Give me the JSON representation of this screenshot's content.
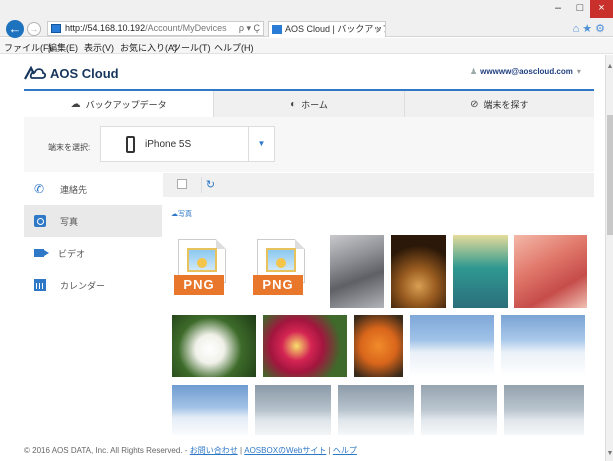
{
  "browser": {
    "url_host": "http://54.168.10.192",
    "url_path": "/Account/MyDevices",
    "url_controls": "ρ ▾ Ç",
    "tab_title": "AOS Cloud | バックアップデータ",
    "tab_close": "×",
    "menu": [
      "ファイル(F)",
      "編集(E)",
      "表示(V)",
      "お気に入り(A)",
      "ツール(T)",
      "ヘルプ(H)"
    ]
  },
  "header": {
    "brand": "AOS Cloud",
    "user_email": "wwwww@aoscloud.com"
  },
  "tabs": [
    {
      "label": "バックアップデータ",
      "icon": "cloud-icon"
    },
    {
      "label": "ホーム",
      "icon": "home-icon"
    },
    {
      "label": "端末を探す",
      "icon": "locate-icon"
    }
  ],
  "device": {
    "label": "端末を選択:",
    "selected": "iPhone 5S"
  },
  "sidebar": {
    "items": [
      {
        "label": "連絡先",
        "icon": "phone-icon"
      },
      {
        "label": "写真",
        "icon": "camera-icon"
      },
      {
        "label": "ビデオ",
        "icon": "video-icon"
      },
      {
        "label": "カレンダー",
        "icon": "calendar-icon"
      }
    ]
  },
  "content": {
    "folder": "写真",
    "png_label": "PNG"
  },
  "footer": {
    "copyright": "© 2016 AOS DATA, Inc. All Rights Reserved.",
    "sep": "-",
    "link1": "お問い合わせ",
    "link2": "AOSBOXのWebサイト",
    "link3": "ヘルプ",
    "divider": "|"
  },
  "colors": {
    "accent": "#2e78c7",
    "png_orange": "#e8772c",
    "close_red": "#c9302c"
  }
}
